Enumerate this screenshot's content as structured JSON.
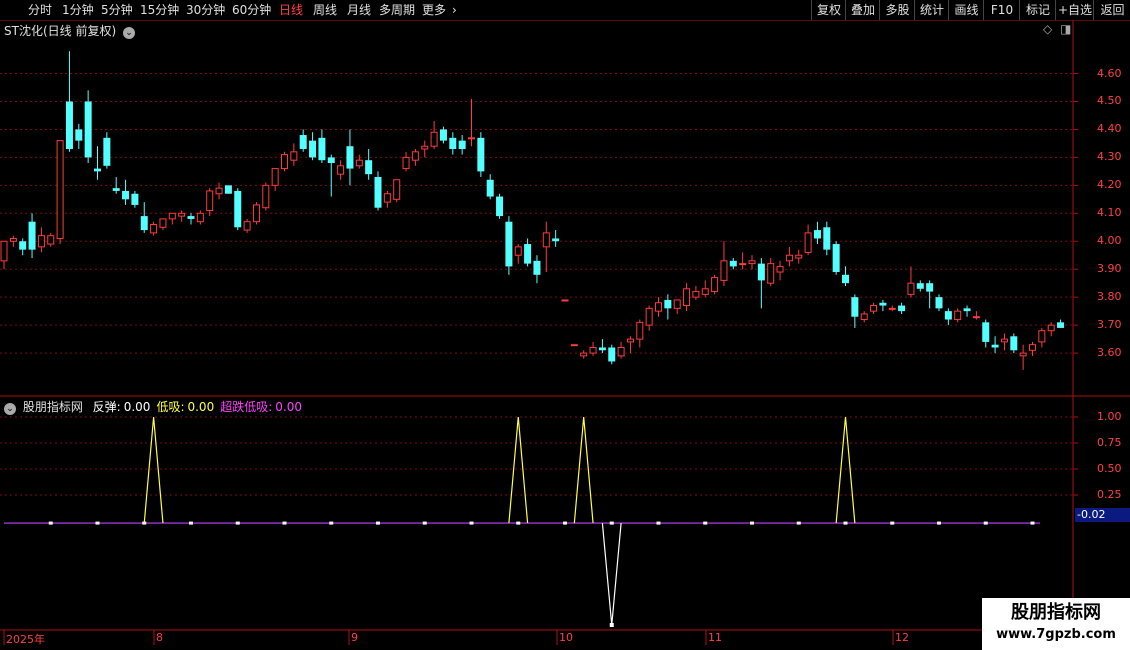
{
  "toolbar": {
    "periods": [
      "分时",
      "1分钟",
      "5分钟",
      "15分钟",
      "30分钟",
      "60分钟",
      "日线",
      "周线",
      "月线",
      "多周期",
      "更多"
    ],
    "active_period": "日线",
    "right_buttons": [
      "复权",
      "叠加",
      "多股",
      "统计",
      "画线",
      "F10",
      "标记",
      "+自选",
      "返回"
    ]
  },
  "main_chart": {
    "title": "ST沈化(日线 前复权)",
    "y_ticks": [
      "4.60",
      "4.50",
      "4.40",
      "4.30",
      "4.20",
      "4.10",
      "4.00",
      "3.90",
      "3.80",
      "3.70",
      "3.60"
    ]
  },
  "indicator": {
    "name": "股朋指标网",
    "items": [
      {
        "label": "反弹:",
        "value": "0.00",
        "color": "#ffffff"
      },
      {
        "label": "低吸:",
        "value": "0.00",
        "color": "#ffff40"
      },
      {
        "label": "超跌低吸:",
        "value": "0.00",
        "color": "#ff40ff"
      }
    ],
    "y_ticks": [
      "1.00",
      "0.75",
      "0.50",
      "0.25"
    ],
    "current_value": "-0.02"
  },
  "x_axis": [
    "2025年",
    "8",
    "9",
    "10",
    "11",
    "12"
  ],
  "watermark": {
    "line1": "股朋指标网",
    "line2": "www.7gpzb.com"
  },
  "colors": {
    "up": "#ff3b3b",
    "down": "#54ffff",
    "accent": "#ff4040",
    "signal": "#ffff40",
    "purple": "#c040ff"
  },
  "chart_data": {
    "type": "candlestick",
    "title": "ST沈化(日线 前复权)",
    "ylim": [
      3.45,
      4.72
    ],
    "candles": [
      [
        3.93,
        4.0,
        3.9,
        4.0
      ],
      [
        4.0,
        4.02,
        3.98,
        4.01
      ],
      [
        4.0,
        4.01,
        3.95,
        3.97
      ],
      [
        4.07,
        4.1,
        3.94,
        3.97
      ],
      [
        3.98,
        4.05,
        3.96,
        4.02
      ],
      [
        3.99,
        4.03,
        3.98,
        4.02
      ],
      [
        4.01,
        4.36,
        3.99,
        4.36
      ],
      [
        4.5,
        4.68,
        4.32,
        4.33
      ],
      [
        4.4,
        4.42,
        4.33,
        4.36
      ],
      [
        4.5,
        4.54,
        4.28,
        4.3
      ],
      [
        4.26,
        4.34,
        4.22,
        4.25
      ],
      [
        4.37,
        4.39,
        4.26,
        4.27
      ],
      [
        4.19,
        4.23,
        4.17,
        4.18
      ],
      [
        4.18,
        4.22,
        4.13,
        4.15
      ],
      [
        4.17,
        4.18,
        4.12,
        4.13
      ],
      [
        4.09,
        4.14,
        4.03,
        4.04
      ],
      [
        4.03,
        4.07,
        4.02,
        4.06
      ],
      [
        4.05,
        4.08,
        4.04,
        4.08
      ],
      [
        4.08,
        4.1,
        4.06,
        4.1
      ],
      [
        4.09,
        4.11,
        4.07,
        4.1
      ],
      [
        4.09,
        4.1,
        4.06,
        4.08
      ],
      [
        4.07,
        4.11,
        4.06,
        4.1
      ],
      [
        4.11,
        4.19,
        4.09,
        4.18
      ],
      [
        4.17,
        4.21,
        4.15,
        4.19
      ],
      [
        4.2,
        4.2,
        4.17,
        4.17
      ],
      [
        4.18,
        4.19,
        4.04,
        4.05
      ],
      [
        4.04,
        4.08,
        4.03,
        4.07
      ],
      [
        4.07,
        4.14,
        4.06,
        4.13
      ],
      [
        4.12,
        4.21,
        4.11,
        4.2
      ],
      [
        4.2,
        4.26,
        4.18,
        4.26
      ],
      [
        4.26,
        4.32,
        4.25,
        4.31
      ],
      [
        4.29,
        4.35,
        4.27,
        4.32
      ],
      [
        4.38,
        4.4,
        4.32,
        4.33
      ],
      [
        4.36,
        4.39,
        4.29,
        4.3
      ],
      [
        4.37,
        4.4,
        4.28,
        4.29
      ],
      [
        4.3,
        4.31,
        4.16,
        4.28
      ],
      [
        4.24,
        4.29,
        4.22,
        4.27
      ],
      [
        4.34,
        4.4,
        4.2,
        4.26
      ],
      [
        4.27,
        4.31,
        4.26,
        4.29
      ],
      [
        4.29,
        4.33,
        4.22,
        4.24
      ],
      [
        4.23,
        4.25,
        4.11,
        4.12
      ],
      [
        4.14,
        4.18,
        4.12,
        4.17
      ],
      [
        4.15,
        4.22,
        4.14,
        4.22
      ],
      [
        4.26,
        4.32,
        4.25,
        4.3
      ],
      [
        4.29,
        4.33,
        4.27,
        4.32
      ],
      [
        4.33,
        4.36,
        4.3,
        4.34
      ],
      [
        4.34,
        4.43,
        4.33,
        4.39
      ],
      [
        4.4,
        4.41,
        4.35,
        4.36
      ],
      [
        4.37,
        4.39,
        4.31,
        4.33
      ],
      [
        4.36,
        4.38,
        4.31,
        4.33
      ],
      [
        4.37,
        4.51,
        4.34,
        4.37
      ],
      [
        4.37,
        4.39,
        4.23,
        4.25
      ],
      [
        4.22,
        4.24,
        4.15,
        4.16
      ],
      [
        4.16,
        4.17,
        4.08,
        4.09
      ],
      [
        4.07,
        4.09,
        3.88,
        3.91
      ],
      [
        3.95,
        3.99,
        3.92,
        3.98
      ],
      [
        3.99,
        4.01,
        3.91,
        3.92
      ],
      [
        3.93,
        3.95,
        3.85,
        3.88
      ],
      [
        3.98,
        4.07,
        3.89,
        4.03
      ],
      [
        4.01,
        4.04,
        3.98,
        4.0
      ],
      [
        3.79,
        3.79,
        3.79,
        3.79
      ],
      [
        3.63,
        3.63,
        3.63,
        3.63
      ],
      [
        3.59,
        3.61,
        3.58,
        3.6
      ],
      [
        3.6,
        3.64,
        3.59,
        3.62
      ],
      [
        3.62,
        3.65,
        3.6,
        3.61
      ],
      [
        3.62,
        3.63,
        3.56,
        3.57
      ],
      [
        3.59,
        3.64,
        3.58,
        3.62
      ],
      [
        3.64,
        3.66,
        3.6,
        3.65
      ],
      [
        3.65,
        3.72,
        3.62,
        3.71
      ],
      [
        3.7,
        3.77,
        3.68,
        3.76
      ],
      [
        3.75,
        3.8,
        3.73,
        3.78
      ],
      [
        3.79,
        3.81,
        3.72,
        3.76
      ],
      [
        3.76,
        3.79,
        3.74,
        3.79
      ],
      [
        3.77,
        3.85,
        3.75,
        3.83
      ],
      [
        3.8,
        3.84,
        3.79,
        3.82
      ],
      [
        3.81,
        3.86,
        3.8,
        3.83
      ],
      [
        3.82,
        3.88,
        3.81,
        3.87
      ],
      [
        3.86,
        4.0,
        3.84,
        3.93
      ],
      [
        3.93,
        3.94,
        3.9,
        3.91
      ],
      [
        3.92,
        3.96,
        3.9,
        3.92
      ],
      [
        3.92,
        3.95,
        3.9,
        3.93
      ],
      [
        3.92,
        3.94,
        3.76,
        3.86
      ],
      [
        3.85,
        3.94,
        3.84,
        3.92
      ],
      [
        3.89,
        3.93,
        3.86,
        3.91
      ],
      [
        3.93,
        3.98,
        3.91,
        3.95
      ],
      [
        3.94,
        3.97,
        3.92,
        3.95
      ],
      [
        3.96,
        4.06,
        3.95,
        4.03
      ],
      [
        4.04,
        4.07,
        3.99,
        4.01
      ],
      [
        4.05,
        4.07,
        3.95,
        3.97
      ],
      [
        3.99,
        4.0,
        3.88,
        3.89
      ],
      [
        3.88,
        3.91,
        3.84,
        3.85
      ],
      [
        3.8,
        3.81,
        3.69,
        3.73
      ],
      [
        3.72,
        3.75,
        3.71,
        3.74
      ],
      [
        3.75,
        3.78,
        3.74,
        3.77
      ],
      [
        3.78,
        3.79,
        3.75,
        3.77
      ],
      [
        3.76,
        3.77,
        3.75,
        3.76
      ],
      [
        3.77,
        3.78,
        3.74,
        3.75
      ],
      [
        3.81,
        3.91,
        3.8,
        3.85
      ],
      [
        3.85,
        3.86,
        3.82,
        3.83
      ],
      [
        3.85,
        3.86,
        3.76,
        3.82
      ],
      [
        3.8,
        3.81,
        3.75,
        3.76
      ],
      [
        3.75,
        3.76,
        3.7,
        3.72
      ],
      [
        3.72,
        3.76,
        3.71,
        3.75
      ],
      [
        3.76,
        3.77,
        3.73,
        3.75
      ],
      [
        3.73,
        3.75,
        3.72,
        3.73
      ],
      [
        3.71,
        3.72,
        3.62,
        3.64
      ],
      [
        3.63,
        3.66,
        3.6,
        3.62
      ],
      [
        3.64,
        3.67,
        3.61,
        3.65
      ],
      [
        3.66,
        3.67,
        3.6,
        3.61
      ],
      [
        3.59,
        3.63,
        3.54,
        3.6
      ],
      [
        3.61,
        3.64,
        3.59,
        3.63
      ],
      [
        3.64,
        3.69,
        3.62,
        3.68
      ],
      [
        3.68,
        3.71,
        3.66,
        3.7
      ],
      [
        3.71,
        3.72,
        3.69,
        3.69
      ]
    ],
    "indicator_series": {
      "name": "低吸",
      "x_signals_at": [
        16,
        55,
        62,
        90
      ],
      "dip_at": 65,
      "dip_value": -0.95,
      "baseline": -0.02
    }
  }
}
